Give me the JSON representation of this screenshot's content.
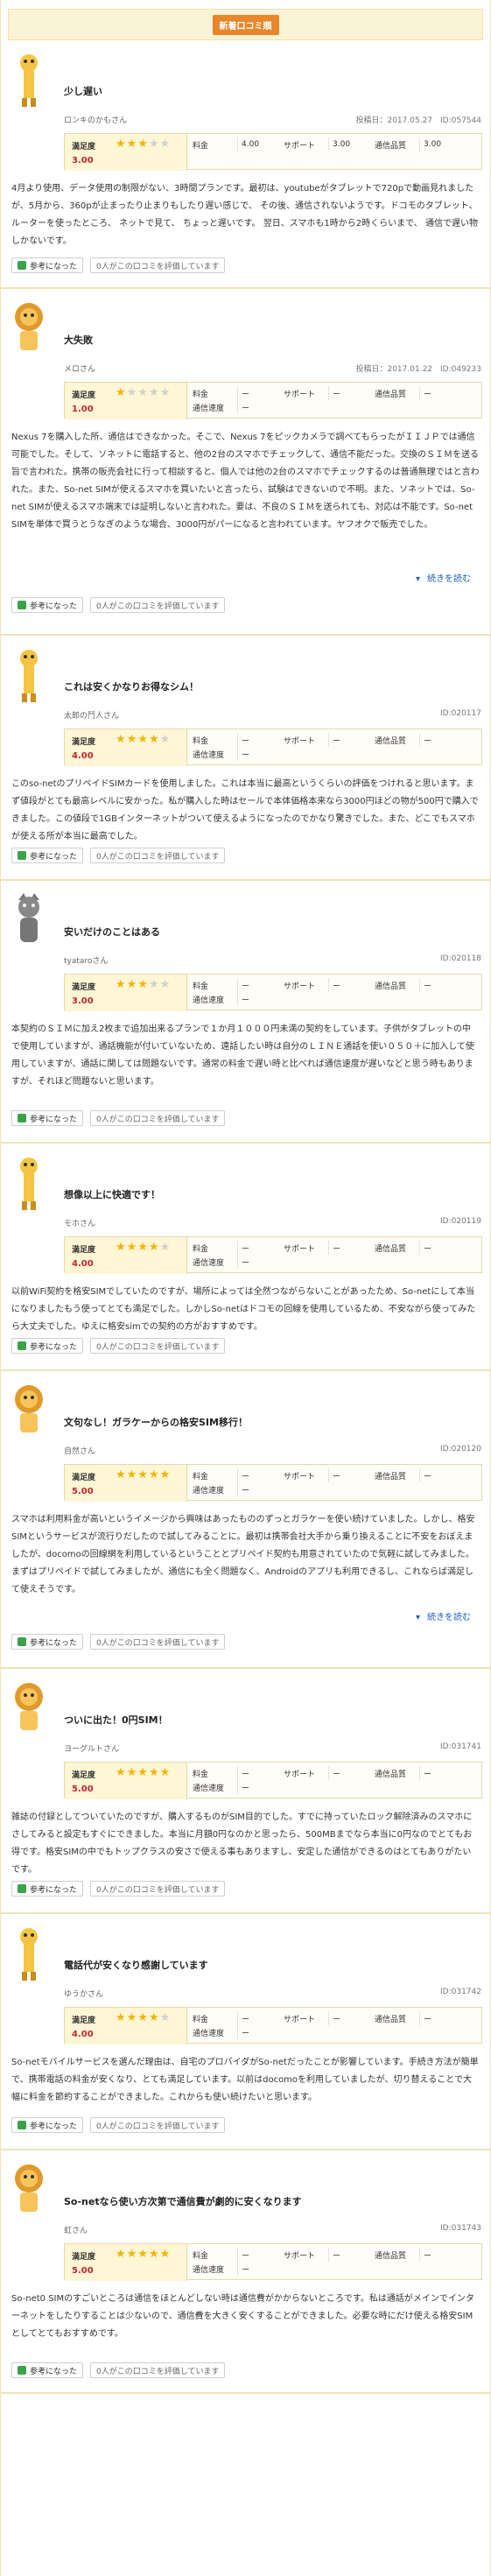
{
  "header": {
    "title": "新着口コミ順"
  },
  "reviews": [
    {
      "title": "少し遅い",
      "author": "ロンキのかもさん",
      "meta": "投稿日：2017.05.27　ID:057544",
      "sat_label": "満足度",
      "stars": 3,
      "score": "3.00",
      "ratings": {
        "fee_label": "料金",
        "fee": "4.00",
        "support_label": "サポート",
        "support": "3.00",
        "speed_label": "通信品質",
        "speed": "3.00"
      },
      "body": "4月より使用、データ使用の制限がない、3時間プランです。最初は、youtubeがタブレットで720pで動画見れましたが、5月から、360pが止まったり止まりもしたり遅い感じで、 その後、通信されないようです。ドコモのタブレット、ルーターを使ったところ、 ネットで見て、 ちょっと遅いです。 翌日、スマホも1時から2時くらいまで、 通信で遅い物しかないです。",
      "helpful_label": "参考になった",
      "count_text": "0人がこの口コミを評価しています",
      "avatar": "giraffe"
    },
    {
      "title": "大失敗",
      "author": "メロさん",
      "meta": "投稿日：2017.01.22　ID:049233",
      "sat_label": "満足度",
      "stars": 1,
      "score": "1.00",
      "ratings": {
        "fee_label": "料金",
        "fee": "ー",
        "support_label": "サポート",
        "support": "ー",
        "speed_label": "通信品質",
        "speed": "ー",
        "speed2_label": "通信速度",
        "speed2": "ー"
      },
      "body": "Nexus 7を購入した所、通信はできなかった。そこで、Nexus 7をピックカメラで調べてもらったがＩＩＪＰでは通信可能でした。そして、ソネットに電話すると、他の2台のスマホでチェックして、通信不能だった。交換のＳＩＭを送る旨で言われた。携帯の販売会社に行って相談すると、個人では他の2台のスマホでチェックするのは普通無理ではと言われた。また、So-net SIMが使えるスマホを買いたいと言ったら、試験はできないので不明。また、ソネットでは、So-net SIMが使えるスマホ端末では証明しないと言われた。要は、不良のＳＩＭを送られても、対応は不能です。So-net SIMを単体で買うとうなぎのような場合、3000円がパーになると言われています。ヤフオクで販売でした。",
      "more_label": "続きを読む",
      "helpful_label": "参考になった",
      "count_text": "0人がこの口コミを評価しています",
      "avatar": "lion"
    },
    {
      "title": "これは安くかなりお得なシム！",
      "author": "太郎の鬥人さん",
      "meta": "ID:020117",
      "sat_label": "満足度",
      "stars": 4,
      "score": "4.00",
      "ratings": {
        "fee_label": "料金",
        "fee": "ー",
        "support_label": "サポート",
        "support": "ー",
        "speed_label": "通信品質",
        "speed": "ー",
        "speed2_label": "通信速度",
        "speed2": "ー"
      },
      "body": "このso-netのプリペイドSIMカードを使用しました。これは本当に最高というくらいの評価をつけれると思います。まず値段がとても最高レベルに安かった。私が購入した時はセールで本体価格本来なら3000円ほどの物が500円で購入できました。この値段で1GBインターネットがついて使えるようになったのでかなり驚きでした。また、どこでもスマホが使える所が本当に最高でした。",
      "helpful_label": "参考になった",
      "count_text": "0人がこの口コミを評価しています",
      "avatar": "giraffe"
    },
    {
      "title": "安いだけのことはある",
      "author": "tyataroさん",
      "meta": "ID:020118",
      "sat_label": "満足度",
      "stars": 3,
      "score": "3.00",
      "ratings": {
        "fee_label": "料金",
        "fee": "ー",
        "support_label": "サポート",
        "support": "ー",
        "speed_label": "通信品質",
        "speed": "ー",
        "speed2_label": "通信速度",
        "speed2": "ー"
      },
      "body": "本契約のＳＩＭに加え2枚まで追加出来るプランで１か月１０００円未満の契約をしています。子供がタブレットの中で使用していますが、通話機能が付いていないため、遠話したい時は自分のＬＩＮＥ通話を使い０５０＋に加入して使用していますが、通話に関しては問題ないです。通常の料金で遅い時と比べれば通信速度が遅いなどと思う時もありますが、それほど問題ないと思います。",
      "helpful_label": "参考になった",
      "count_text": "0人がこの口コミを評価しています",
      "avatar": "cat"
    },
    {
      "title": "想像以上に快適です！",
      "author": "モホさん",
      "meta": "ID:020119",
      "sat_label": "満足度",
      "stars": 4,
      "score": "4.00",
      "ratings": {
        "fee_label": "料金",
        "fee": "ー",
        "support_label": "サポート",
        "support": "ー",
        "speed_label": "通信品質",
        "speed": "ー",
        "speed2_label": "通信速度",
        "speed2": "ー"
      },
      "body": "以前WiFi契約を格安SIMでしていたのですが、場所によっては全然つながらないことがあったため、So-netにして本当になりましたもう使ってとても満足でした。しかしSo-netはドコモの回線を使用しているため、不安ながら使ってみたら大丈夫でした。ゆえに格安simでの契約の方がおすすめです。",
      "helpful_label": "参考になった",
      "count_text": "0人がこの口コミを評価しています",
      "avatar": "giraffe"
    },
    {
      "title": "文句なし！ガラケーからの格安SIM移行！",
      "author": "自然さん",
      "meta": "ID:020120",
      "sat_label": "満足度",
      "stars": 5,
      "score": "5.00",
      "ratings": {
        "fee_label": "料金",
        "fee": "ー",
        "support_label": "サポート",
        "support": "ー",
        "speed_label": "通信品質",
        "speed": "ー",
        "speed2_label": "通信速度",
        "speed2": "ー"
      },
      "body": "スマホは利用料金が高いというイメージから興味はあったもののずっとガラケーを使い続けていました。しかし、格安SIMというサービスが流行りだしたので試してみることに。最初は携帯会社大手から乗り換えることに不安をおぼえましたが、docomoの回線網を利用しているということとプリペイド契約も用意されていたので気軽に試してみました。まずはプリペイドで試してみましたが、通信にも全く問題なく、Androidのアプリも利用できるし、これならば満足して使えそうです。",
      "more_label": "続きを読む",
      "helpful_label": "参考になった",
      "count_text": "0人がこの口コミを評価しています",
      "avatar": "lion"
    },
    {
      "title": "ついに出た！0円SIM！",
      "author": "ヨーグルトさん",
      "meta": "ID:031741",
      "sat_label": "満足度",
      "stars": 5,
      "score": "5.00",
      "ratings": {
        "fee_label": "料金",
        "fee": "ー",
        "support_label": "サポート",
        "support": "ー",
        "speed_label": "通信品質",
        "speed": "ー",
        "speed2_label": "通信速度",
        "speed2": "ー"
      },
      "body": "雑誌の付録としてついていたのですが、購入するものがSIM目的でした。すでに持っていたロック解除済みのスマホにさしてみると設定もすぐにできました。本当に月額0円なのかと思ったら、500MBまでなら本当に0円なのでとてもお得です。格安SIMの中でもトップクラスの安さで使える事もありますし、安定した通信ができるのはとてもありがたいです。",
      "helpful_label": "参考になった",
      "count_text": "0人がこの口コミを評価しています",
      "avatar": "lion"
    },
    {
      "title": "電話代が安くなり感謝しています",
      "author": "ゆうかさん",
      "meta": "ID:031742",
      "sat_label": "満足度",
      "stars": 4,
      "score": "4.00",
      "ratings": {
        "fee_label": "料金",
        "fee": "ー",
        "support_label": "サポート",
        "support": "ー",
        "speed_label": "通信品質",
        "speed": "ー",
        "speed2_label": "通信速度",
        "speed2": "ー"
      },
      "body": "So-netモバイルサービスを選んだ理由は、自宅のプロバイダがSo-netだったことが影響しています。手続き方法が簡単で、携帯電話の料金が安くなり、とても満足しています。以前はdocomoを利用していましたが、切り替えることで大幅に料金を節約することができました。これからも使い続けたいと思います。",
      "helpful_label": "参考になった",
      "count_text": "0人がこの口コミを評価しています",
      "avatar": "giraffe"
    },
    {
      "title": "So-netなら使い方次第で通信費が劇的に安くなります",
      "author": "虹さん",
      "meta": "ID:031743",
      "sat_label": "満足度",
      "stars": 5,
      "score": "5.00",
      "ratings": {
        "fee_label": "料金",
        "fee": "ー",
        "support_label": "サポート",
        "support": "ー",
        "speed_label": "通信品質",
        "speed": "ー",
        "speed2_label": "通信速度",
        "speed2": "ー"
      },
      "body": "So-net0 SIMのすごいところは通信をほとんどしない時は通信費がかからないところです。私は通話がメインでインターネットをしたりすることは少ないので、通信費を大きく安くすることができました。必要な時にだけ使える格安SIMとしてとてもおすすめです。",
      "helpful_label": "参考になった",
      "count_text": "0人がこの口コミを評価しています",
      "avatar": "lion"
    }
  ]
}
